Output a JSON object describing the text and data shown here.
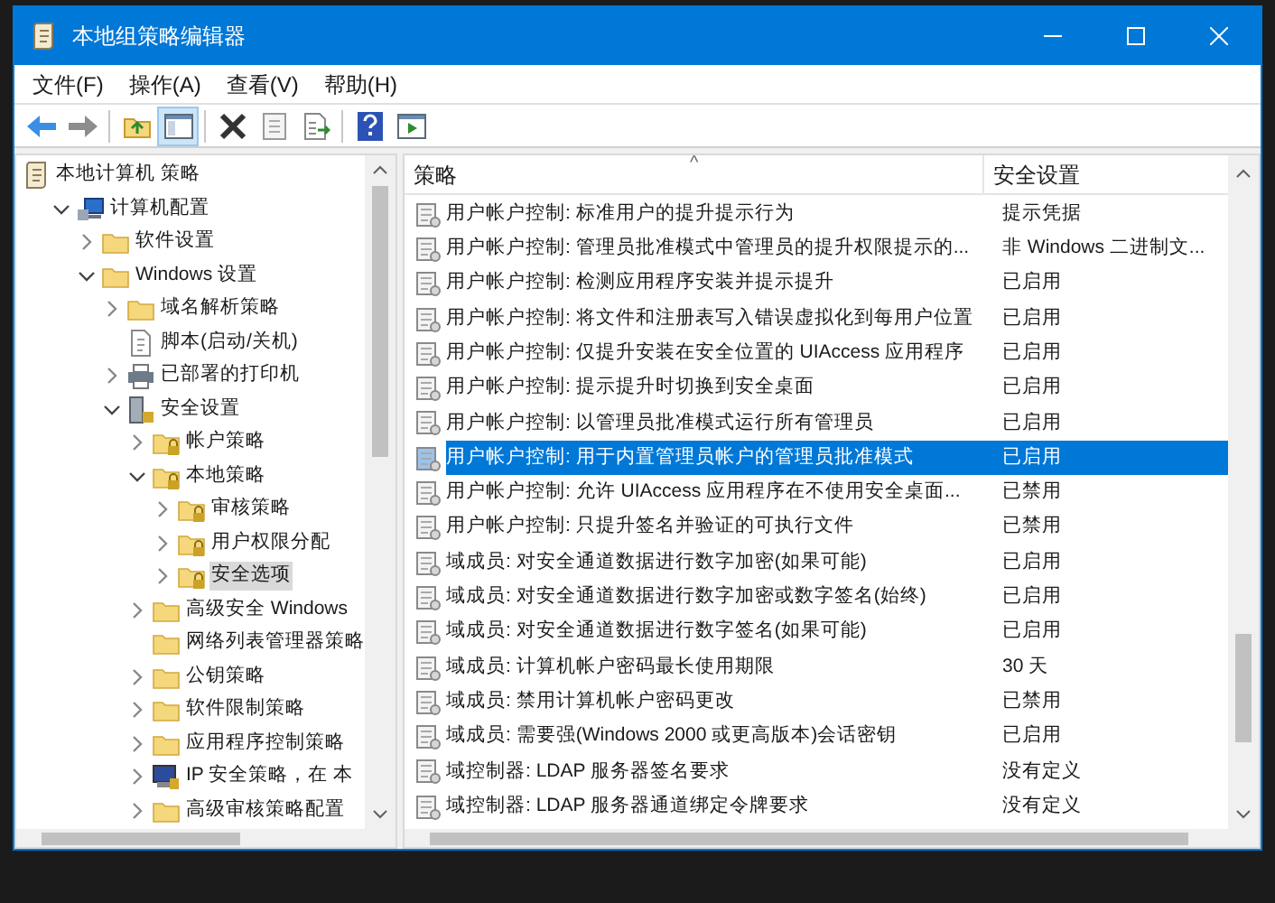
{
  "window": {
    "title": "本地组策略编辑器"
  },
  "menu": [
    "文件(F)",
    "操作(A)",
    "查看(V)",
    "帮助(H)"
  ],
  "toolbar": [
    {
      "kind": "back"
    },
    {
      "kind": "forward"
    },
    {
      "kind": "sep"
    },
    {
      "kind": "up"
    },
    {
      "kind": "pane",
      "selected": true
    },
    {
      "kind": "sep"
    },
    {
      "kind": "delete"
    },
    {
      "kind": "properties"
    },
    {
      "kind": "export"
    },
    {
      "kind": "sep"
    },
    {
      "kind": "help"
    },
    {
      "kind": "view"
    }
  ],
  "tree": [
    {
      "label": "本地计算机 策略",
      "kind": "policy",
      "selected": false,
      "children": [
        {
          "label": "计算机配置",
          "kind": "computer",
          "expandable": true,
          "expanded": true,
          "selected": false,
          "children": [
            {
              "label": "软件设置",
              "kind": "folder",
              "expandable": true,
              "expanded": false,
              "selected": false
            },
            {
              "label": "Windows 设置",
              "kind": "folder",
              "expandable": true,
              "expanded": true,
              "selected": false,
              "children": [
                {
                  "label": "域名解析策略",
                  "kind": "folder",
                  "expandable": true,
                  "expanded": false,
                  "selected": false
                },
                {
                  "label": "脚本(启动/关机)",
                  "kind": "script",
                  "expandable": false,
                  "expanded": false,
                  "selected": false
                },
                {
                  "label": "已部署的打印机",
                  "kind": "printer",
                  "expandable": true,
                  "expanded": false,
                  "selected": false
                },
                {
                  "label": "安全设置",
                  "kind": "security",
                  "expandable": true,
                  "expanded": true,
                  "selected": false,
                  "children": [
                    {
                      "label": "帐户策略",
                      "kind": "lockfolder",
                      "expandable": true,
                      "expanded": false,
                      "selected": false
                    },
                    {
                      "label": "本地策略",
                      "kind": "lockfolder",
                      "expandable": true,
                      "expanded": true,
                      "selected": false,
                      "children": [
                        {
                          "label": "审核策略",
                          "kind": "lockfolder",
                          "expandable": true,
                          "expanded": false,
                          "selected": false
                        },
                        {
                          "label": "用户权限分配",
                          "kind": "lockfolder",
                          "expandable": true,
                          "expanded": false,
                          "selected": false
                        },
                        {
                          "label": "安全选项",
                          "kind": "lockfolder",
                          "expandable": true,
                          "expanded": false,
                          "selected": true
                        }
                      ]
                    },
                    {
                      "label": "高级安全 Windows",
                      "kind": "folder",
                      "expandable": true,
                      "expanded": false,
                      "selected": false
                    },
                    {
                      "label": "网络列表管理器策略",
                      "kind": "folder",
                      "expandable": false,
                      "expanded": false,
                      "selected": false
                    },
                    {
                      "label": "公钥策略",
                      "kind": "folder",
                      "expandable": true,
                      "expanded": false,
                      "selected": false
                    },
                    {
                      "label": "软件限制策略",
                      "kind": "folder",
                      "expandable": true,
                      "expanded": false,
                      "selected": false
                    },
                    {
                      "label": "应用程序控制策略",
                      "kind": "folder",
                      "expandable": true,
                      "expanded": false,
                      "selected": false
                    },
                    {
                      "label": "IP 安全策略，在 本",
                      "kind": "ip",
                      "expandable": true,
                      "expanded": false,
                      "selected": false
                    },
                    {
                      "label": "高级审核策略配置",
                      "kind": "folder",
                      "expandable": true,
                      "expanded": false,
                      "selected": false
                    }
                  ]
                }
              ]
            }
          ]
        }
      ]
    }
  ],
  "table": {
    "columns": [
      "策略",
      "安全设置"
    ],
    "sort_mark": "^",
    "rows": [
      {
        "policy": "用户帐户控制: 标准用户的提升提示行为",
        "setting": "提示凭据",
        "selected": false
      },
      {
        "policy": "用户帐户控制: 管理员批准模式中管理员的提升权限提示的...",
        "setting": "非 Windows 二进制文...",
        "selected": false
      },
      {
        "policy": "用户帐户控制: 检测应用程序安装并提示提升",
        "setting": "已启用",
        "selected": false
      },
      {
        "policy": "用户帐户控制: 将文件和注册表写入错误虚拟化到每用户位置",
        "setting": "已启用",
        "selected": false
      },
      {
        "policy": "用户帐户控制: 仅提升安装在安全位置的 UIAccess 应用程序",
        "setting": "已启用",
        "selected": false
      },
      {
        "policy": "用户帐户控制: 提示提升时切换到安全桌面",
        "setting": "已启用",
        "selected": false
      },
      {
        "policy": "用户帐户控制: 以管理员批准模式运行所有管理员",
        "setting": "已启用",
        "selected": false
      },
      {
        "policy": "用户帐户控制: 用于内置管理员帐户的管理员批准模式",
        "setting": "已启用",
        "selected": true
      },
      {
        "policy": "用户帐户控制: 允许 UIAccess 应用程序在不使用安全桌面...",
        "setting": "已禁用",
        "selected": false
      },
      {
        "policy": "用户帐户控制: 只提升签名并验证的可执行文件",
        "setting": "已禁用",
        "selected": false
      },
      {
        "policy": "域成员: 对安全通道数据进行数字加密(如果可能)",
        "setting": "已启用",
        "selected": false
      },
      {
        "policy": "域成员: 对安全通道数据进行数字加密或数字签名(始终)",
        "setting": "已启用",
        "selected": false
      },
      {
        "policy": "域成员: 对安全通道数据进行数字签名(如果可能)",
        "setting": "已启用",
        "selected": false
      },
      {
        "policy": "域成员: 计算机帐户密码最长使用期限",
        "setting": "30 天",
        "selected": false
      },
      {
        "policy": "域成员: 禁用计算机帐户密码更改",
        "setting": "已禁用",
        "selected": false
      },
      {
        "policy": "域成员: 需要强(Windows 2000 或更高版本)会话密钥",
        "setting": "已启用",
        "selected": false
      },
      {
        "policy": "域控制器: LDAP 服务器签名要求",
        "setting": "没有定义",
        "selected": false
      },
      {
        "policy": "域控制器: LDAP 服务器通道绑定令牌要求",
        "setting": "没有定义",
        "selected": false
      }
    ]
  }
}
